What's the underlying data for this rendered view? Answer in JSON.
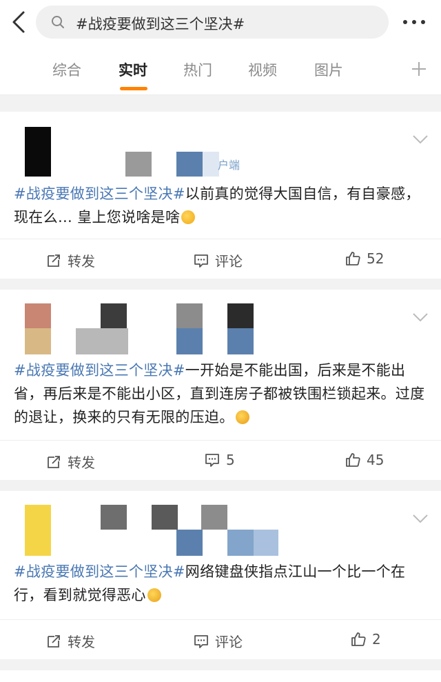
{
  "header": {
    "search_query": "#战疫要做到这三个坚决#"
  },
  "tabs": [
    {
      "label": "综合",
      "active": false
    },
    {
      "label": "实时",
      "active": true
    },
    {
      "label": "热门",
      "active": false
    },
    {
      "label": "视频",
      "active": false
    },
    {
      "label": "图片",
      "active": false
    }
  ],
  "accent_color": "#ff8200",
  "link_color": "#4a78b4",
  "posts": [
    {
      "source_fragment": "户端",
      "hashtag": "#战疫要做到这三个坚决#",
      "text": "以前真的觉得大国自信，有自豪感，现在么… 皇上您说啥是啥",
      "emoji": "kissing-face-emoji",
      "repost_label": "转发",
      "comment_label": "评论",
      "like_count": "52"
    },
    {
      "hashtag": "#战疫要做到这三个坚决#",
      "text": "一开始是不能出国，后来是不能出省，再后来是不能出小区，直到连房子都被铁围栏锁起来。过度的退让，换来的只有无限的压迫。",
      "emoji": "crying-face-emoji",
      "repost_label": "转发",
      "comment_count": "5",
      "like_count": "45"
    },
    {
      "hashtag": "#战疫要做到这三个坚决#",
      "text": "网络键盘侠指点江山一个比一个在行，看到就觉得恶心",
      "emoji": "vomiting-face-emoji",
      "repost_label": "转发",
      "comment_label": "评论",
      "like_count": "2"
    }
  ]
}
